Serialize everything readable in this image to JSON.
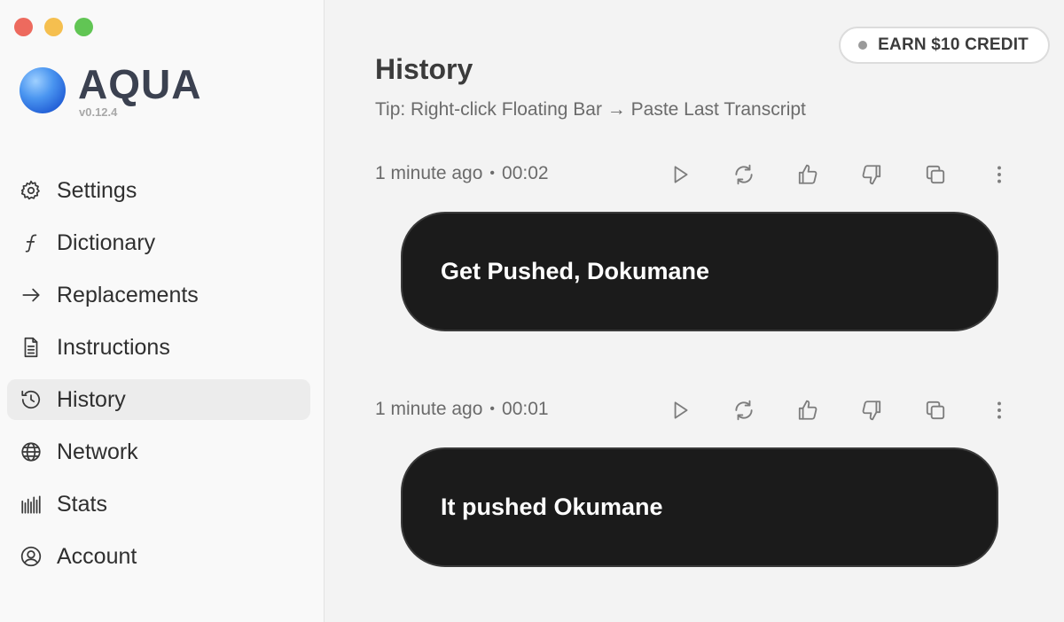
{
  "app": {
    "name": "AQUA",
    "version": "v0.12.4"
  },
  "sidebar": {
    "items": [
      {
        "label": "Settings",
        "icon": "gear-icon"
      },
      {
        "label": "Dictionary",
        "icon": "script-f-icon"
      },
      {
        "label": "Replacements",
        "icon": "arrow-right-icon"
      },
      {
        "label": "Instructions",
        "icon": "document-icon"
      },
      {
        "label": "History",
        "icon": "history-icon",
        "active": true
      },
      {
        "label": "Network",
        "icon": "globe-icon"
      },
      {
        "label": "Stats",
        "icon": "bars-icon"
      },
      {
        "label": "Account",
        "icon": "user-circle-icon"
      }
    ]
  },
  "header": {
    "earn_label": "EARN $10 CREDIT",
    "title": "History",
    "tip": "Tip: Right-click Floating Bar → Paste Last Transcript"
  },
  "entries": [
    {
      "time_ago": "1 minute ago",
      "duration": "00:02",
      "transcript": "Get Pushed, Dokumane"
    },
    {
      "time_ago": "1 minute ago",
      "duration": "00:01",
      "transcript": "It pushed Okumane"
    }
  ],
  "colors": {
    "sidebar_bg": "#f9f9f9",
    "main_bg": "#f3f3f3",
    "bubble_bg": "#1b1b1b",
    "brand_text": "#3b4150",
    "brand_orb": "#4a95f0"
  }
}
